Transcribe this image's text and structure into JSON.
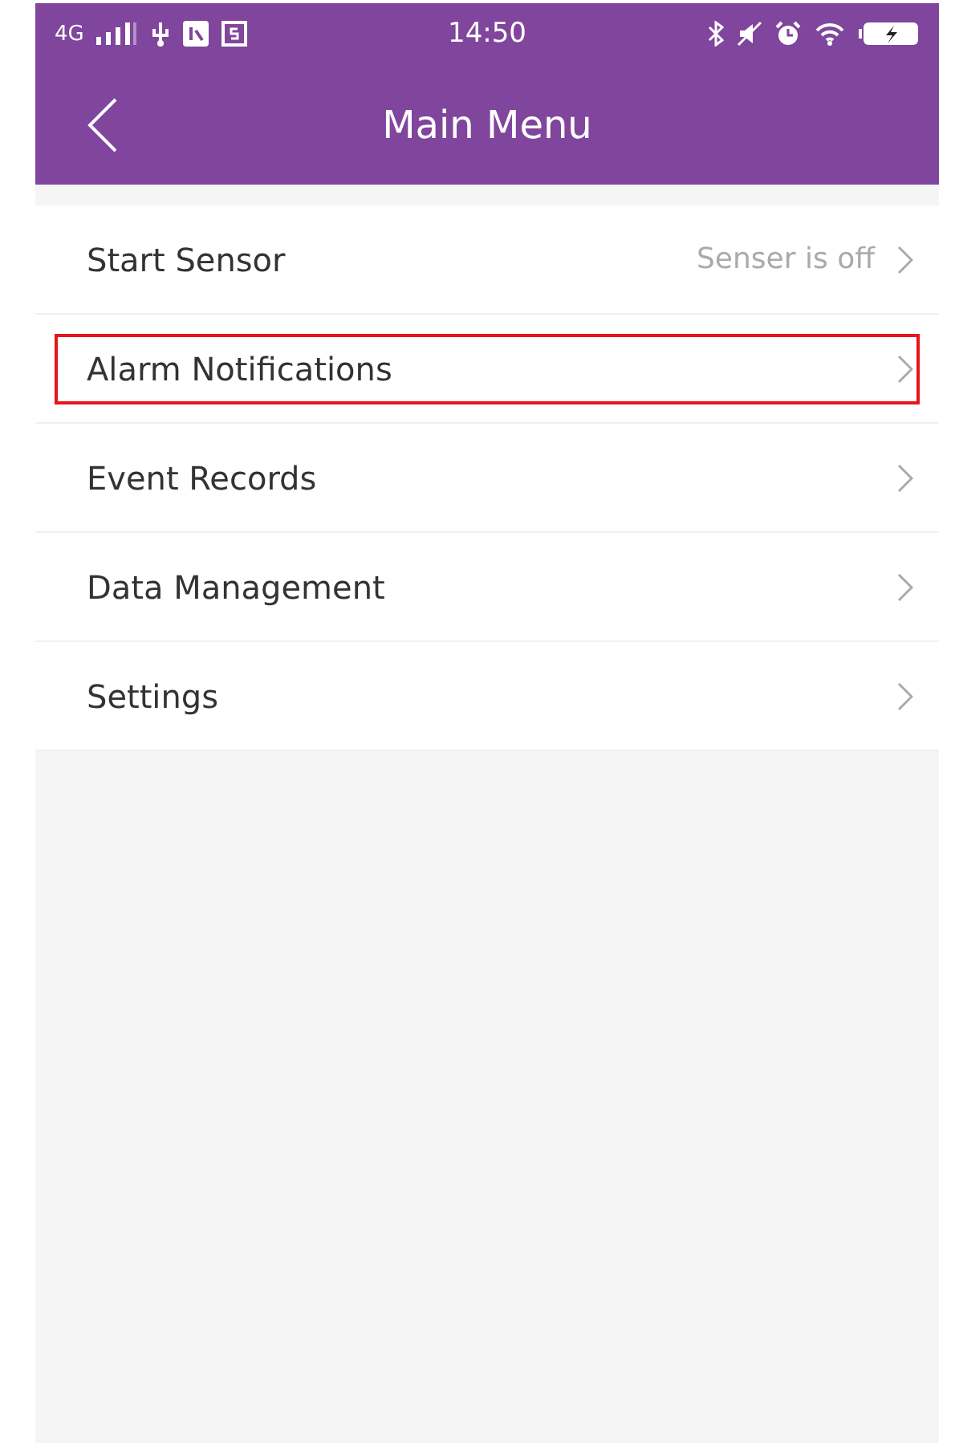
{
  "status_bar": {
    "network": "4G",
    "time": "14:50"
  },
  "header": {
    "title": "Main Menu"
  },
  "menu": [
    {
      "label": "Start Sensor",
      "value": "Senser is off",
      "highlighted": false
    },
    {
      "label": "Alarm Notifications",
      "highlighted": true
    },
    {
      "label": "Event Records",
      "highlighted": false
    },
    {
      "label": "Data Management",
      "highlighted": false
    },
    {
      "label": "Settings",
      "highlighted": false
    }
  ]
}
